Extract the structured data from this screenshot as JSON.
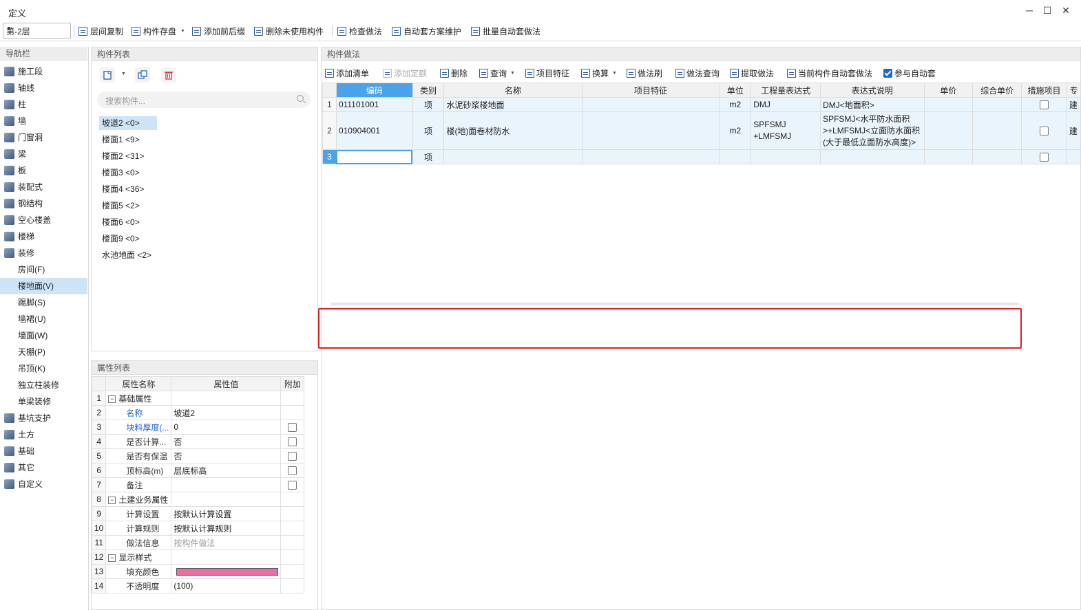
{
  "window": {
    "title": "定义",
    "min": "─",
    "max": "☐",
    "close": "✕"
  },
  "toolbar": {
    "floor": "第-2层",
    "buttons": [
      "层间复制",
      "构件存盘",
      "添加前后缀",
      "删除未使用构件",
      "检查做法",
      "自动套方案维护",
      "批量自动套做法"
    ]
  },
  "nav": {
    "header": "导航栏",
    "items": [
      "施工段",
      "轴线",
      "柱",
      "墙",
      "门窗洞",
      "梁",
      "板",
      "装配式",
      "钢结构",
      "空心楼盖",
      "楼梯",
      "装修"
    ],
    "sub_items": [
      "房间(F)",
      "楼地面(V)",
      "踢脚(S)",
      "墙裙(U)",
      "墙面(W)",
      "天棚(P)",
      "吊顶(K)",
      "独立柱装修",
      "单梁装修"
    ],
    "bottom_items": [
      "基坑支护",
      "土方",
      "基础",
      "其它",
      "自定义"
    ]
  },
  "component_list": {
    "header": "构件列表",
    "search_placeholder": "搜索构件...",
    "items": [
      "坡道2 <0>",
      "楼面1 <9>",
      "楼面2 <31>",
      "楼面3 <0>",
      "楼面4 <36>",
      "楼面5 <2>",
      "楼面6 <0>",
      "楼面9 <0>",
      "水池地面 <2>"
    ]
  },
  "property_list": {
    "header": "属性列表",
    "columns": [
      "属性名称",
      "属性值",
      "附加"
    ],
    "rows": [
      {
        "n": "1",
        "name": "基础属性",
        "value": ""
      },
      {
        "n": "2",
        "name": "名称",
        "value": "坡道2"
      },
      {
        "n": "3",
        "name": "块料厚度(...",
        "value": "0"
      },
      {
        "n": "4",
        "name": "是否计算...",
        "value": "否"
      },
      {
        "n": "5",
        "name": "是否有保温",
        "value": "否"
      },
      {
        "n": "6",
        "name": "顶标高(m)",
        "value": "层底标高"
      },
      {
        "n": "7",
        "name": "备注",
        "value": ""
      },
      {
        "n": "8",
        "name": "土建业务属性",
        "value": ""
      },
      {
        "n": "9",
        "name": "计算设置",
        "value": "按默认计算设置"
      },
      {
        "n": "10",
        "name": "计算规则",
        "value": "按默认计算规则"
      },
      {
        "n": "11",
        "name": "做法信息",
        "value": "按构件做法"
      },
      {
        "n": "12",
        "name": "显示样式",
        "value": ""
      },
      {
        "n": "13",
        "name": "填充颜色",
        "value": ""
      },
      {
        "n": "14",
        "name": "不透明度",
        "value": "(100)"
      }
    ],
    "fill_color": "#ec6fa3"
  },
  "method": {
    "header": "构件做法",
    "buttons": [
      "添加清单",
      "添加定额",
      "删除",
      "查询",
      "项目特征",
      "换算",
      "做法刷",
      "做法查询",
      "提取做法",
      "当前构件自动套做法",
      "参与自动套"
    ],
    "columns": [
      "编码",
      "类别",
      "名称",
      "项目特征",
      "单位",
      "工程量表达式",
      "表达式说明",
      "单价",
      "综合单价",
      "措施项目",
      "专"
    ],
    "rows": [
      {
        "n": "1",
        "code": "011101001",
        "type": "项",
        "name": "水泥砂浆楼地面",
        "unit": "m2",
        "expr": "DMJ",
        "desc": "DMJ<地面积>",
        "major": "建"
      },
      {
        "n": "2",
        "code": "010904001",
        "type": "项",
        "name": "楼(地)面卷材防水",
        "unit": "m2",
        "expr": "SPFSMJ +LMFSMJ",
        "desc": "SPFSMJ<水平防水面积>+LMFSMJ<立面防水面积(大于最低立面防水高度)>",
        "major": "建"
      },
      {
        "n": "3",
        "code": "",
        "type": "项",
        "name": "",
        "unit": "",
        "expr": "",
        "desc": "",
        "major": ""
      }
    ]
  }
}
